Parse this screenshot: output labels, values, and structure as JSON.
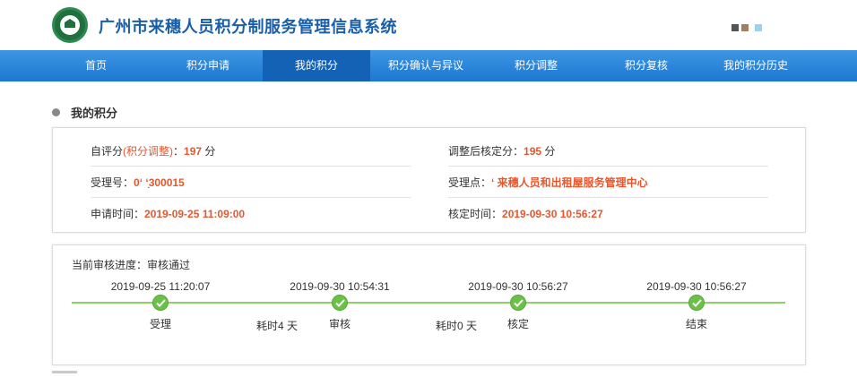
{
  "header": {
    "title": "广州市来穗人员积分制服务管理信息系统",
    "logo_icon": "emblem-icon",
    "window_controls": [
      {
        "name": "minimize-icon",
        "color": "#555555"
      },
      {
        "name": "restore-icon",
        "color": "#a0805f"
      },
      {
        "name": "close-icon",
        "color": "#9bd3ea"
      }
    ]
  },
  "nav": {
    "items": [
      {
        "label": "首页",
        "active": false
      },
      {
        "label": "积分申请",
        "active": false
      },
      {
        "label": "我的积分",
        "active": true
      },
      {
        "label": "积分确认与异议",
        "active": false
      },
      {
        "label": "积分调整",
        "active": false
      },
      {
        "label": "积分复核",
        "active": false
      },
      {
        "label": "我的积分历史",
        "active": false
      }
    ]
  },
  "section": {
    "title": "我的积分"
  },
  "info": {
    "self_score_label": "自评分",
    "adjust_link": "(积分调整)",
    "self_score_sep": "：",
    "self_score_value": "197",
    "unit": "分",
    "adjusted_label": "调整后核定分：",
    "adjusted_value": "195",
    "accept_no_label": "受理号：",
    "accept_no_value": "0‘          ‘̣300015",
    "accept_point_label": "受理点：",
    "accept_point_value": "‘      来穗人员和出租屋服务管理中心",
    "apply_time_label": "申请时间：",
    "apply_time_value": "2019-09-25 11:09:00",
    "verify_time_label": "核定时间：",
    "verify_time_value": "2019-09-30 10:56:27"
  },
  "progress": {
    "title": "当前审核进度：审核通过",
    "steps": [
      {
        "time": "2019-09-25 11:20:07",
        "label": "受理"
      },
      {
        "time": "2019-09-30 10:54:31",
        "label": "审核"
      },
      {
        "time": "2019-09-30 10:56:27",
        "label": "核定"
      },
      {
        "time": "2019-09-30 10:56:27",
        "label": "结束"
      }
    ],
    "durations": [
      "耗时4 天",
      "耗时0 天"
    ]
  },
  "colors": {
    "nav_blue": "#1c78d2",
    "nav_active": "#1462b6",
    "title_blue": "#1a5fa8",
    "accent_orange": "#e6572d",
    "check_green": "#6cc04a"
  }
}
